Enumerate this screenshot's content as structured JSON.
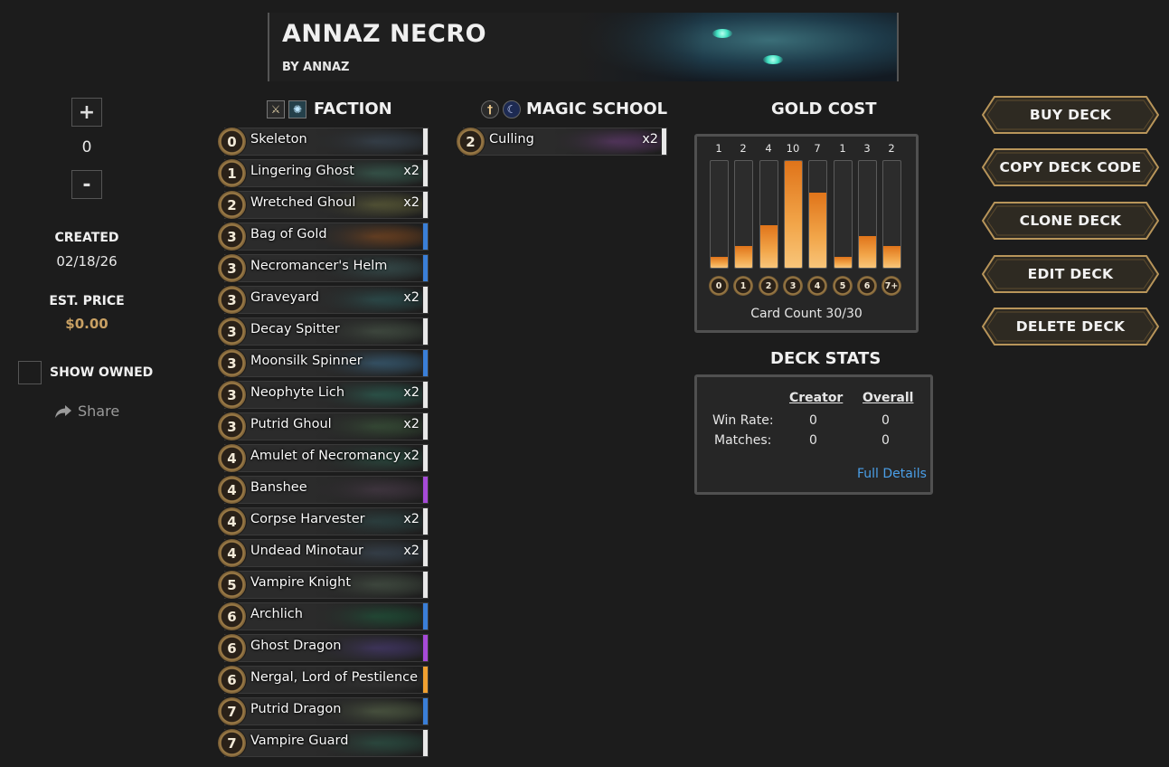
{
  "header": {
    "title": "ANNAZ NECRO",
    "author": "BY ANNAZ"
  },
  "sidebar": {
    "plus_label": "+",
    "quantity": "0",
    "minus_label": "-",
    "created_label": "CREATED",
    "created_value": "02/18/26",
    "price_label": "EST. PRICE",
    "price_value": "$0.00",
    "show_owned_label": "SHOW OWNED",
    "share_label": "Share"
  },
  "faction": {
    "title": "FACTION",
    "cards": [
      {
        "cost": "0",
        "name": "Skeleton",
        "count": "",
        "rarity_color": "#e8e8e8",
        "art_color": "#3a4a5a"
      },
      {
        "cost": "1",
        "name": "Lingering Ghost",
        "count": "x2",
        "rarity_color": "#e8e8e8",
        "art_color": "#3a6a5a"
      },
      {
        "cost": "2",
        "name": "Wretched Ghoul",
        "count": "x2",
        "rarity_color": "#e8e8e8",
        "art_color": "#6a6a3a"
      },
      {
        "cost": "3",
        "name": "Bag of Gold",
        "count": "",
        "rarity_color": "#3a7fd8",
        "art_color": "#8a4a1a"
      },
      {
        "cost": "3",
        "name": "Necromancer's Helm",
        "count": "",
        "rarity_color": "#3a7fd8",
        "art_color": "#3a5a5a"
      },
      {
        "cost": "3",
        "name": "Graveyard",
        "count": "x2",
        "rarity_color": "#e8e8e8",
        "art_color": "#2a5a5a"
      },
      {
        "cost": "3",
        "name": "Decay Spitter",
        "count": "",
        "rarity_color": "#e8e8e8",
        "art_color": "#4a5a4a"
      },
      {
        "cost": "3",
        "name": "Moonsilk Spinner",
        "count": "",
        "rarity_color": "#3a7fd8",
        "art_color": "#3a6a8a"
      },
      {
        "cost": "3",
        "name": "Neophyte Lich",
        "count": "x2",
        "rarity_color": "#e8e8e8",
        "art_color": "#2a6a5a"
      },
      {
        "cost": "3",
        "name": "Putrid Ghoul",
        "count": "x2",
        "rarity_color": "#e8e8e8",
        "art_color": "#3a5a3a"
      },
      {
        "cost": "4",
        "name": "Amulet of Necromancy",
        "count": "x2",
        "rarity_color": "#e8e8e8",
        "art_color": "#2a5a4a"
      },
      {
        "cost": "4",
        "name": "Banshee",
        "count": "",
        "rarity_color": "#a64ad8",
        "art_color": "#4a3a4a"
      },
      {
        "cost": "4",
        "name": "Corpse Harvester",
        "count": "x2",
        "rarity_color": "#e8e8e8",
        "art_color": "#2a4a4a"
      },
      {
        "cost": "4",
        "name": "Undead Minotaur",
        "count": "x2",
        "rarity_color": "#e8e8e8",
        "art_color": "#3a4a5a"
      },
      {
        "cost": "5",
        "name": "Vampire Knight",
        "count": "",
        "rarity_color": "#e8e8e8",
        "art_color": "#4a5a4a"
      },
      {
        "cost": "6",
        "name": "Archlich",
        "count": "",
        "rarity_color": "#3a7fd8",
        "art_color": "#1a5a3a"
      },
      {
        "cost": "6",
        "name": "Ghost Dragon",
        "count": "",
        "rarity_color": "#a64ad8",
        "art_color": "#4a3a7a"
      },
      {
        "cost": "6",
        "name": "Nergal, Lord of Pestilence",
        "count": "",
        "rarity_color": "#f0a030",
        "art_color": "#3a3a3a"
      },
      {
        "cost": "7",
        "name": "Putrid Dragon",
        "count": "",
        "rarity_color": "#3a7fd8",
        "art_color": "#5a6a4a"
      },
      {
        "cost": "7",
        "name": "Vampire Guard",
        "count": "",
        "rarity_color": "#e8e8e8",
        "art_color": "#2a5a4a"
      }
    ]
  },
  "magic_school": {
    "title": "MAGIC SCHOOL",
    "cards": [
      {
        "cost": "2",
        "name": "Culling",
        "count": "x2",
        "rarity_color": "#e8e8e8",
        "art_color": "#6a3a7a"
      }
    ]
  },
  "gold_cost": {
    "title": "GOLD COST",
    "card_count_label": "Card Count 30/30",
    "chart_data": {
      "type": "bar",
      "categories": [
        "0",
        "1",
        "2",
        "3",
        "4",
        "5",
        "6",
        "7+"
      ],
      "values": [
        1,
        2,
        4,
        10,
        7,
        1,
        3,
        2
      ],
      "ylim": [
        0,
        10
      ]
    }
  },
  "deck_stats": {
    "title": "DECK STATS",
    "creator_header": "Creator",
    "overall_header": "Overall",
    "win_rate_label": "Win Rate:",
    "win_rate_creator": "0",
    "win_rate_overall": "0",
    "matches_label": "Matches:",
    "matches_creator": "0",
    "matches_overall": "0",
    "full_details_label": "Full Details"
  },
  "actions": {
    "buy": "BUY DECK",
    "copy": "COPY DECK CODE",
    "clone": "CLONE DECK",
    "edit": "EDIT DECK",
    "delete": "DELETE DECK"
  }
}
